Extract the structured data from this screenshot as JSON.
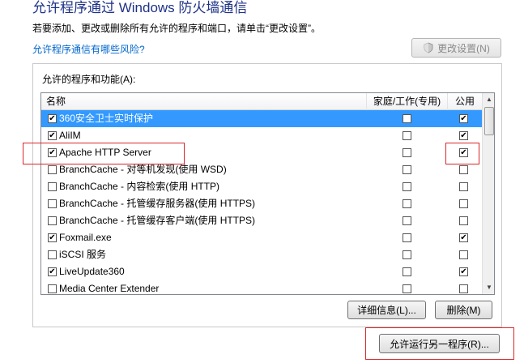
{
  "title": "允许程序通过 Windows 防火墙通信",
  "description": "若要添加、更改或删除所有允许的程序和端口，请单击“更改设置”。",
  "risk_link": "允许程序通信有哪些风险?",
  "change_settings_button": "更改设置(N)",
  "group_label": "允许的程序和功能(A):",
  "columns": {
    "name": "名称",
    "home": "家庭/工作(专用)",
    "public": "公用"
  },
  "rows": [
    {
      "name": "360安全卫士实时保护",
      "enabled": true,
      "home": false,
      "public": true,
      "selected": true
    },
    {
      "name": "AliIM",
      "enabled": true,
      "home": false,
      "public": true,
      "selected": false
    },
    {
      "name": "Apache HTTP Server",
      "enabled": true,
      "home": false,
      "public": true,
      "selected": false
    },
    {
      "name": "BranchCache - 对等机发现(使用 WSD)",
      "enabled": false,
      "home": false,
      "public": false,
      "selected": false
    },
    {
      "name": "BranchCache - 内容检索(使用 HTTP)",
      "enabled": false,
      "home": false,
      "public": false,
      "selected": false
    },
    {
      "name": "BranchCache - 托管缓存服务器(使用 HTTPS)",
      "enabled": false,
      "home": false,
      "public": false,
      "selected": false
    },
    {
      "name": "BranchCache - 托管缓存客户端(使用 HTTPS)",
      "enabled": false,
      "home": false,
      "public": false,
      "selected": false
    },
    {
      "name": "Foxmail.exe",
      "enabled": true,
      "home": false,
      "public": true,
      "selected": false
    },
    {
      "name": "iSCSI 服务",
      "enabled": false,
      "home": false,
      "public": false,
      "selected": false
    },
    {
      "name": "LiveUpdate360",
      "enabled": true,
      "home": false,
      "public": true,
      "selected": false
    },
    {
      "name": "Media Center Extender",
      "enabled": false,
      "home": false,
      "public": false,
      "selected": false
    }
  ],
  "details_button": "详细信息(L)...",
  "delete_button": "删除(M)",
  "allow_another_button": "允许运行另一程序(R)...",
  "icons": {
    "shield": "uac-shield-icon",
    "check": "✔",
    "scroll_up": "▲",
    "scroll_down": "▼"
  },
  "colors": {
    "title": "#1e3287",
    "link": "#0066cc",
    "selection": "#3399ff",
    "highlight": "#d9262c"
  }
}
